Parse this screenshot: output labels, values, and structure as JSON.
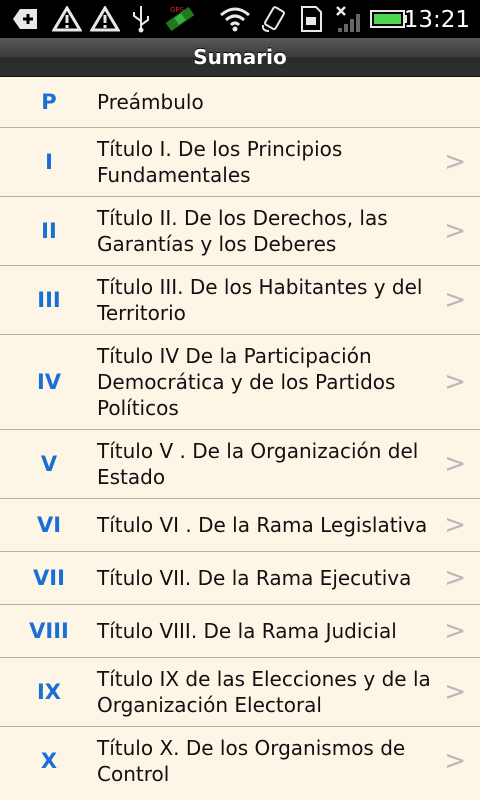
{
  "status_bar": {
    "time": "13:21",
    "icons": [
      "usb-debug-icon",
      "warning-icon",
      "warning-icon",
      "usb-icon",
      "gps-satellite-icon",
      "wifi-icon",
      "rotate-icon",
      "sd-card-icon",
      "signal-no-service-icon",
      "battery-full-icon"
    ]
  },
  "header": {
    "title": "Sumario"
  },
  "items": [
    {
      "num": "P",
      "label": "Preámbulo",
      "has_chevron": false
    },
    {
      "num": "I",
      "label": "Título I. De los Principios Fundamentales",
      "has_chevron": true
    },
    {
      "num": "II",
      "label": "Título II.  De los Derechos, las Garantías y los Deberes",
      "has_chevron": true
    },
    {
      "num": "III",
      "label": "Título III. De los Habitantes y del Territorio",
      "has_chevron": true
    },
    {
      "num": "IV",
      "label": "Título IV De la Participación Democrática y de los Partidos Políticos",
      "has_chevron": true
    },
    {
      "num": "V",
      "label": "Título V . De la Organización del Estado",
      "has_chevron": true
    },
    {
      "num": "VI",
      "label": "Título VI . De la Rama Legislativa",
      "has_chevron": true
    },
    {
      "num": "VII",
      "label": "Título VII. De la Rama Ejecutiva",
      "has_chevron": true
    },
    {
      "num": "VIII",
      "label": "Título VIII. De la Rama Judicial",
      "has_chevron": true
    },
    {
      "num": "IX",
      "label": "Título IX  de las Elecciones y de la Organización Electoral",
      "has_chevron": true
    },
    {
      "num": "X",
      "label": "Título X. De los Organismos de Control",
      "has_chevron": true
    }
  ],
  "chevron": ">"
}
